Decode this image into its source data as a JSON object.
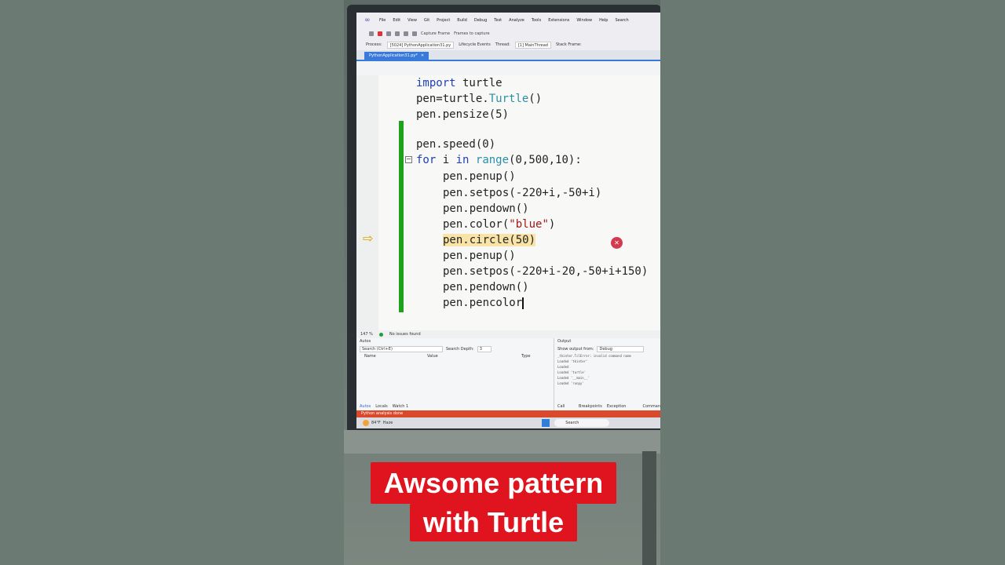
{
  "menu": [
    "File",
    "Edit",
    "View",
    "Git",
    "Project",
    "Build",
    "Debug",
    "Test",
    "Analyze",
    "Tools",
    "Extensions",
    "Window",
    "Help"
  ],
  "search_label": "Search",
  "process": {
    "label": "Process:",
    "value": "[5024] PythonApplication31.py",
    "lifecycle": "Lifecycle Events",
    "thread_label": "Thread:",
    "thread": "[1] MainThread",
    "stack_label": "Stack Frame:"
  },
  "toolbar": {
    "capture": "Capture Frame",
    "frames": "Frames to capture"
  },
  "tab": {
    "name": "PythonApplication31.py*",
    "close": "✕"
  },
  "code": {
    "l1_kw": "import",
    "l1_rest": " turtle",
    "l2_a": "pen=turtle.",
    "l2_cls": "Turtle",
    "l2_b": "()",
    "l3": "pen.pensize(5)",
    "l4": "pen.speed(0)",
    "l5_kw1": "for",
    "l5_a": " i ",
    "l5_kw2": "in",
    "l5_sp": " ",
    "l5_cls": "range",
    "l5_b": "(0,500,10):",
    "l6": "pen.penup()",
    "l7": "pen.setpos(-220+i,-50+i)",
    "l8": "pen.pendown()",
    "l9_a": "pen.color(",
    "l9_str": "\"blue\"",
    "l9_b": ")",
    "l10": "pen.circle(50)",
    "l11": "pen.penup()",
    "l12": "pen.setpos(-220+i-20,-50+i+150)",
    "l13": "pen.pendown()",
    "l14": "pen.pencolor"
  },
  "status": {
    "zoom": "147 %",
    "issues": "No issues found"
  },
  "autos": {
    "title": "Autos",
    "search": "Search (Ctrl+E)",
    "depth_label": "Search Depth:",
    "depth": "3",
    "cols": [
      "Name",
      "Value",
      "Type"
    ],
    "tabs": [
      "Autos",
      "Locals",
      "Watch 1"
    ]
  },
  "output": {
    "title": "Output",
    "show_label": "Show output from:",
    "source": "Debug",
    "lines": [
      "_tkinter.TclError: invalid command name",
      "Loaded 'tkinter'",
      "Loaded",
      "Loaded 'turtle'",
      "Loaded '__main__'",
      "Loaded 'runpy'"
    ],
    "tabs": [
      "Call Stack",
      "Breakpoints",
      "Exception Settings",
      "Comman"
    ]
  },
  "vs_status": "Python analysis done",
  "taskbar": {
    "temp": "84°F",
    "weather": "Haze",
    "search": "Search"
  },
  "caption": {
    "line1": "Awsome pattern",
    "line2": "with Turtle"
  }
}
